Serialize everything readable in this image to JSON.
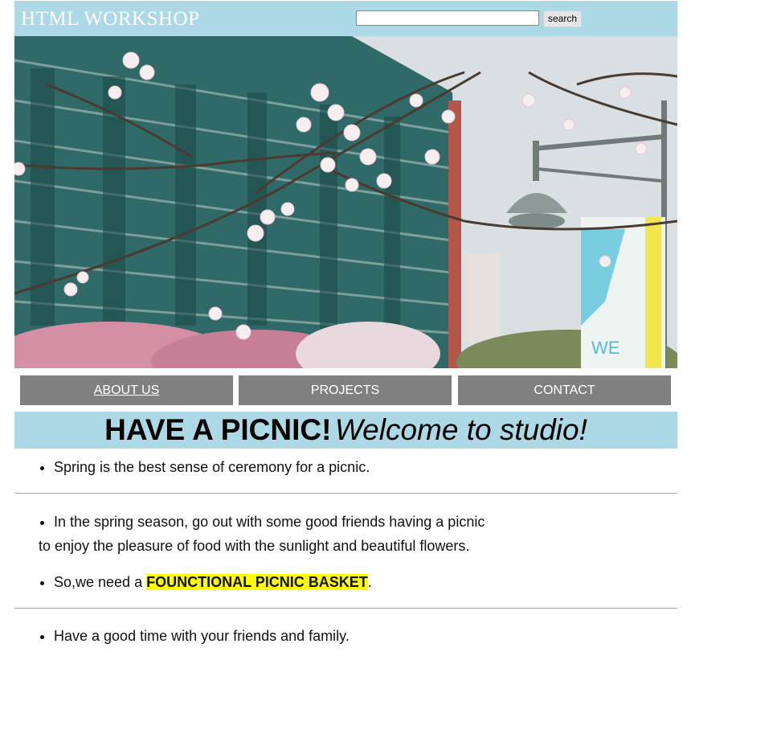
{
  "header": {
    "logo": "HTML WORKSHOP",
    "search_placeholder": "",
    "search_button": "search"
  },
  "hero": {
    "image_description_icon": "cherry-blossom-photo"
  },
  "nav": {
    "items": [
      {
        "label": "ABOUT US",
        "active": true
      },
      {
        "label": "PROJECTS",
        "active": false
      },
      {
        "label": "CONTACT",
        "active": false
      }
    ]
  },
  "banner": {
    "bold": "HAVE A PICNIC!",
    "italic": "Welcome to studio!"
  },
  "content": {
    "item1": "Spring is the best sense of ceremony for a picnic.",
    "item2_line1": "In the spring season, go out with some good friends having a picnic",
    "item2_line2": "to enjoy the pleasure of food with the sunlight and beautiful flowers.",
    "item3_prefix": "So,we need a ",
    "item3_highlight": "FOUNCTIONAL PICNIC BASKET",
    "item3_suffix": ".",
    "item4": "Have a good time with your friends and family."
  },
  "colors": {
    "header_bg": "#add8e6",
    "nav_bg": "#808080",
    "highlight": "#ffff00"
  }
}
